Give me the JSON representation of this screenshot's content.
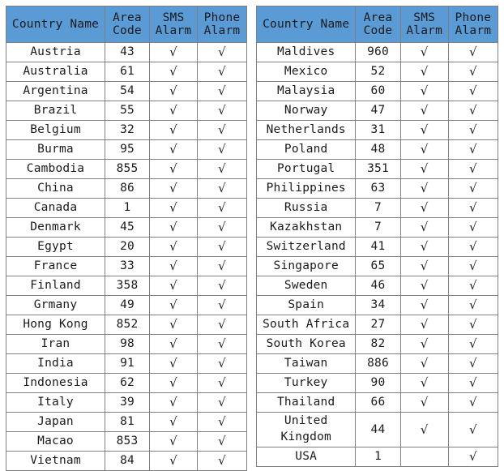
{
  "columns": [
    {
      "key": "name",
      "label_lines": [
        "Country Name"
      ],
      "name": "column-header-country-name"
    },
    {
      "key": "code",
      "label_lines": [
        "Area",
        "Code"
      ],
      "name": "column-header-area-code"
    },
    {
      "key": "sms",
      "label_lines": [
        "SMS",
        "Alarm"
      ],
      "name": "column-header-sms-alarm"
    },
    {
      "key": "phone",
      "label_lines": [
        "Phone",
        "Alarm"
      ],
      "name": "column-header-phone-alarm"
    }
  ],
  "check_symbol": "√",
  "colors": {
    "header_background": "#5B9BD5",
    "header_text": "#1A1A1A",
    "border": "#7F7F7F",
    "cell_background": "#FFFFFF",
    "cell_text": "#1A1A1A"
  },
  "left_table": {
    "name": "country-area-code-table-left",
    "rows": [
      {
        "name": "Austria",
        "code": "43",
        "sms": "√",
        "phone": "√"
      },
      {
        "name": "Australia",
        "code": "61",
        "sms": "√",
        "phone": "√"
      },
      {
        "name": "Argentina",
        "code": "54",
        "sms": "√",
        "phone": "√"
      },
      {
        "name": "Brazil",
        "code": "55",
        "sms": "√",
        "phone": "√"
      },
      {
        "name": "Belgium",
        "code": "32",
        "sms": "√",
        "phone": "√"
      },
      {
        "name": "Burma",
        "code": "95",
        "sms": "√",
        "phone": "√"
      },
      {
        "name": "Cambodia",
        "code": "855",
        "sms": "√",
        "phone": "√"
      },
      {
        "name": "China",
        "code": "86",
        "sms": "√",
        "phone": "√"
      },
      {
        "name": "Canada",
        "code": "1",
        "sms": "√",
        "phone": "√"
      },
      {
        "name": "Denmark",
        "code": "45",
        "sms": "√",
        "phone": "√"
      },
      {
        "name": "Egypt",
        "code": "20",
        "sms": "√",
        "phone": "√"
      },
      {
        "name": "France",
        "code": "33",
        "sms": "√",
        "phone": "√"
      },
      {
        "name": "Finland",
        "code": "358",
        "sms": "√",
        "phone": "√"
      },
      {
        "name": "Grmany",
        "code": "49",
        "sms": "√",
        "phone": "√"
      },
      {
        "name": "Hong Kong",
        "code": "852",
        "sms": "√",
        "phone": "√"
      },
      {
        "name": "Iran",
        "code": "98",
        "sms": "√",
        "phone": "√"
      },
      {
        "name": "India",
        "code": "91",
        "sms": "√",
        "phone": "√"
      },
      {
        "name": "Indonesia",
        "code": "62",
        "sms": "√",
        "phone": "√"
      },
      {
        "name": "Italy",
        "code": "39",
        "sms": "√",
        "phone": "√"
      },
      {
        "name": "Japan",
        "code": "81",
        "sms": "√",
        "phone": "√"
      },
      {
        "name": "Macao",
        "code": "853",
        "sms": "√",
        "phone": "√"
      },
      {
        "name": "Vietnam",
        "code": "84",
        "sms": "√",
        "phone": "√"
      }
    ]
  },
  "right_table": {
    "name": "country-area-code-table-right",
    "rows": [
      {
        "name": "Maldives",
        "code": "960",
        "sms": "√",
        "phone": "√"
      },
      {
        "name": "Mexico",
        "code": "52",
        "sms": "√",
        "phone": "√"
      },
      {
        "name": "Malaysia",
        "code": "60",
        "sms": "√",
        "phone": "√"
      },
      {
        "name": "Norway",
        "code": "47",
        "sms": "√",
        "phone": "√"
      },
      {
        "name": "Netherlands",
        "code": "31",
        "sms": "√",
        "phone": "√"
      },
      {
        "name": "Poland",
        "code": "48",
        "sms": "√",
        "phone": "√"
      },
      {
        "name": "Portugal",
        "code": "351",
        "sms": "√",
        "phone": "√"
      },
      {
        "name": "Philippines",
        "code": "63",
        "sms": "√",
        "phone": "√"
      },
      {
        "name": "Russia",
        "code": "7",
        "sms": "√",
        "phone": "√"
      },
      {
        "name": "Kazakhstan",
        "code": "7",
        "sms": "√",
        "phone": "√"
      },
      {
        "name": "Switzerland",
        "code": "41",
        "sms": "√",
        "phone": "√"
      },
      {
        "name": "Singapore",
        "code": "65",
        "sms": "√",
        "phone": "√"
      },
      {
        "name": "Sweden",
        "code": "46",
        "sms": "√",
        "phone": "√"
      },
      {
        "name": "Spain",
        "code": "34",
        "sms": "√",
        "phone": "√"
      },
      {
        "name": "South Africa",
        "code": "27",
        "sms": "√",
        "phone": "√"
      },
      {
        "name": "South Korea",
        "code": "82",
        "sms": "√",
        "phone": "√"
      },
      {
        "name": "Taiwan",
        "code": "886",
        "sms": "√",
        "phone": "√"
      },
      {
        "name": "Turkey",
        "code": "90",
        "sms": "√",
        "phone": "√"
      },
      {
        "name": "Thailand",
        "code": "66",
        "sms": "√",
        "phone": "√"
      },
      {
        "name": "United Kingdom",
        "code": "44",
        "sms": "√",
        "phone": "√",
        "tall": true
      },
      {
        "name": "USA",
        "code": "1",
        "sms": "",
        "phone": "√"
      }
    ]
  }
}
